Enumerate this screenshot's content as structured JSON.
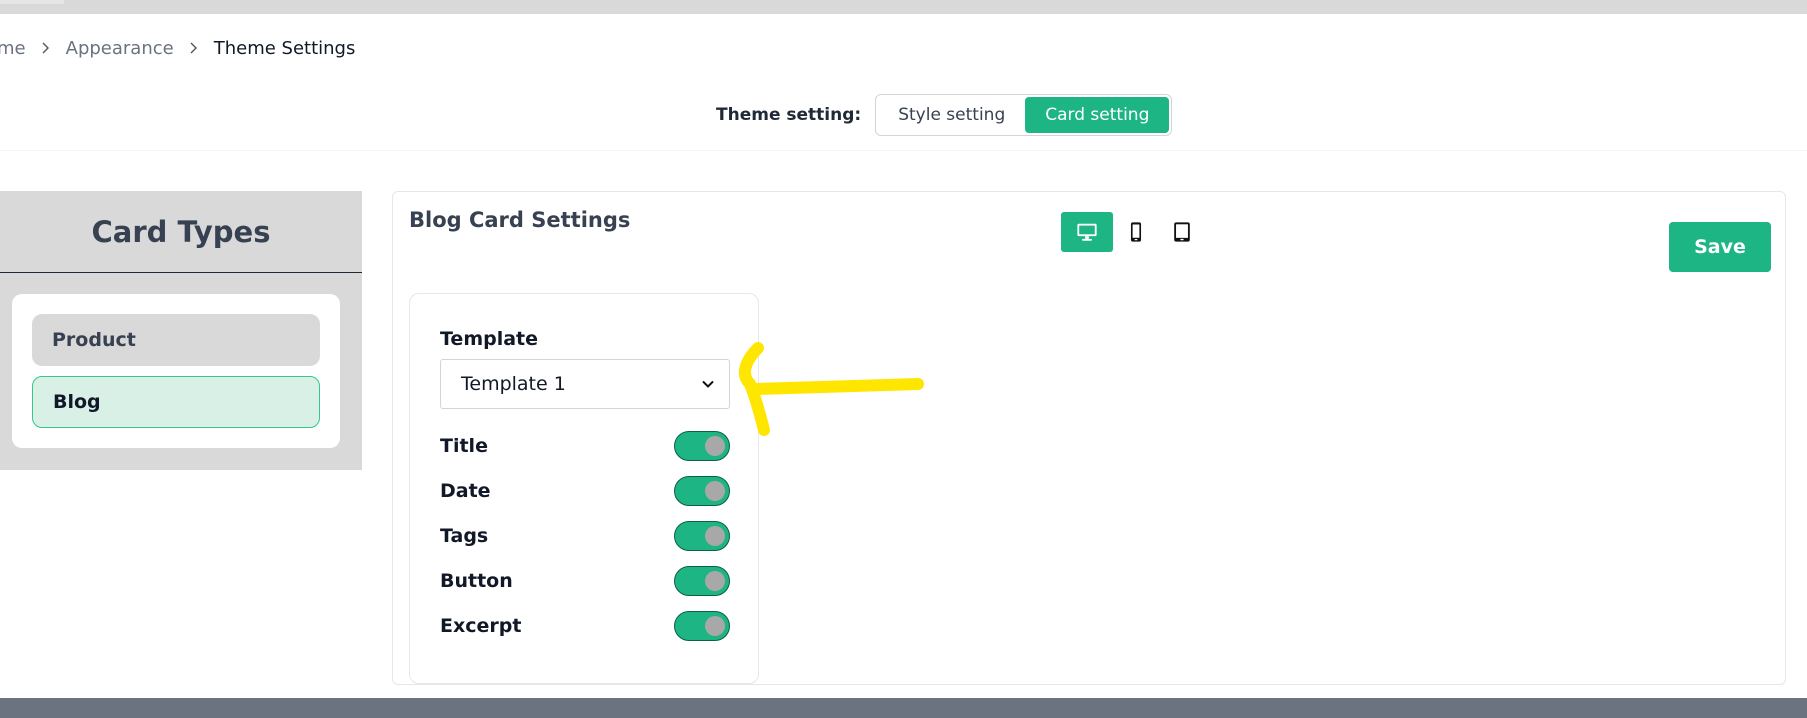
{
  "breadcrumb": {
    "items": [
      "ome",
      "Appearance",
      "Theme Settings"
    ]
  },
  "theme_setting": {
    "label": "Theme setting:",
    "options": [
      "Style setting",
      "Card setting"
    ],
    "selected": "Card setting"
  },
  "card_types": {
    "title": "Card Types",
    "items": [
      "Product",
      "Blog"
    ],
    "selected": "Blog"
  },
  "main": {
    "title": "Blog Card Settings",
    "save_label": "Save",
    "devices": [
      "desktop-icon",
      "mobile-icon",
      "tablet-icon"
    ],
    "active_device": "desktop-icon"
  },
  "settings": {
    "template_label": "Template",
    "template_value": "Template 1",
    "toggles": [
      {
        "label": "Title",
        "on": true
      },
      {
        "label": "Date",
        "on": true
      },
      {
        "label": "Tags",
        "on": true
      },
      {
        "label": "Button",
        "on": true
      },
      {
        "label": "Excerpt",
        "on": true
      }
    ]
  },
  "colors": {
    "accent": "#1db584",
    "annotation": "#ffe600",
    "footer": "#6b7280",
    "panel": "#d9d9d9"
  }
}
